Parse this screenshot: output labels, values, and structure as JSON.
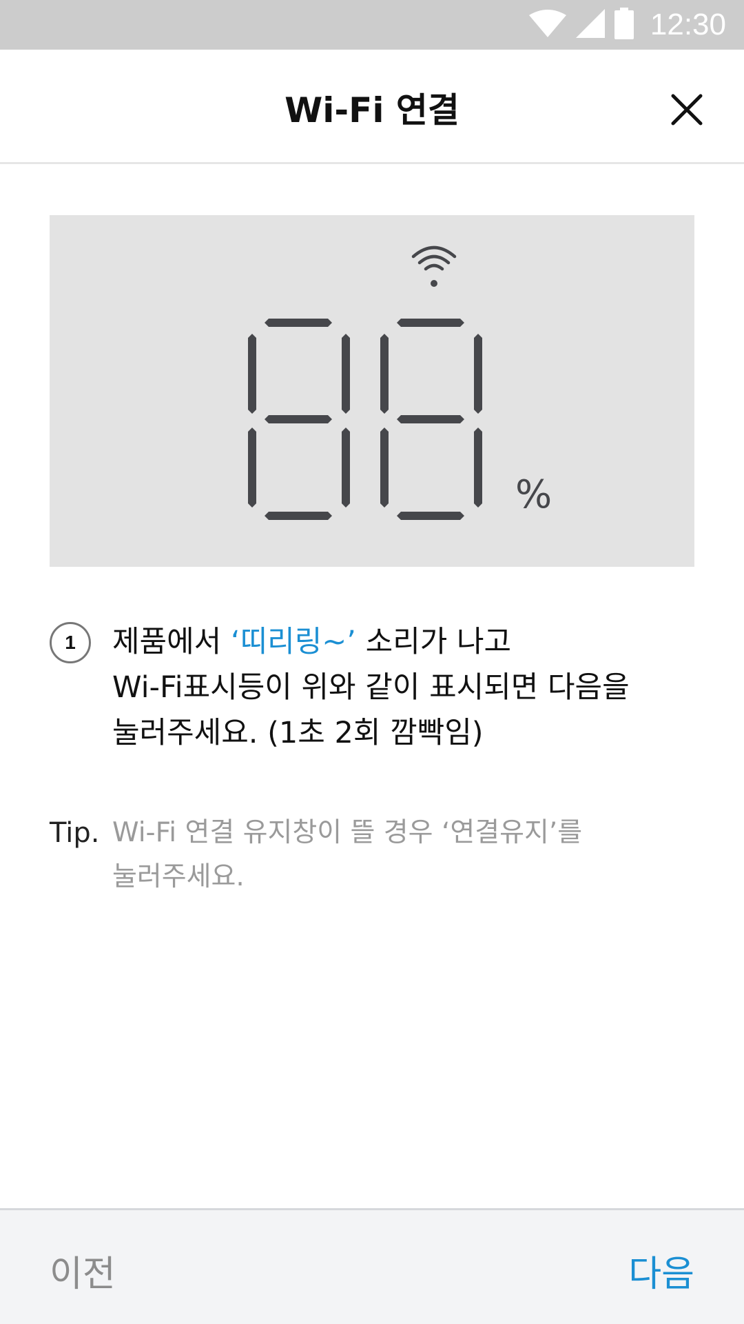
{
  "status_bar": {
    "time": "12:30",
    "icons": [
      "wifi-icon",
      "cell-signal-icon",
      "battery-icon"
    ]
  },
  "app_bar": {
    "title": "Wi-Fi 연결",
    "close_icon": "close-icon"
  },
  "display": {
    "digits": "88",
    "unit": "%",
    "wifi_icon": "wifi-icon",
    "segment_color": "#46474b",
    "background": "#e3e3e3"
  },
  "instruction": {
    "step_number": "1",
    "line1_pre": "제품에서 ",
    "line1_highlight": "‘띠리링~’",
    "line1_post": " 소리가 나고",
    "line2": "Wi-Fi표시등이 위와 같이 표시되면 다음을",
    "line3": "눌러주세요. (1초 2회 깜빡임)"
  },
  "tip": {
    "label": "Tip.",
    "line1": "Wi-Fi 연결 유지창이 뜰 경우 ‘연결유지’를",
    "line2": "눌러주세요."
  },
  "bottom_bar": {
    "prev_label": "이전",
    "next_label": "다음"
  },
  "colors": {
    "accent": "#1b8fd3",
    "status_bar": "#cccccc",
    "bottom_bar": "#f3f4f6"
  }
}
